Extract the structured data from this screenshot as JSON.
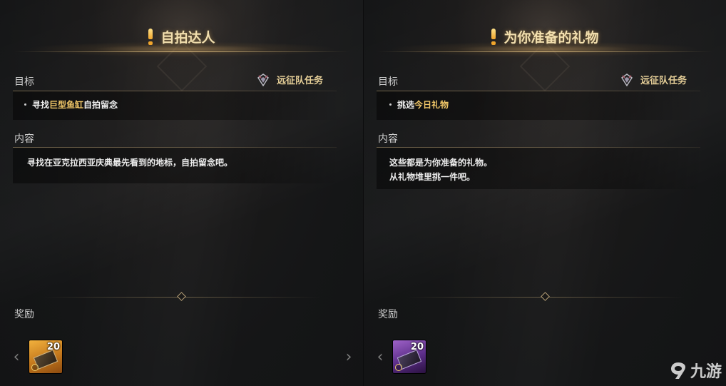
{
  "panels": [
    {
      "title": "自拍达人",
      "objective_label": "目标",
      "quest_type": "远征队任务",
      "objective": {
        "prefix": "寻找",
        "highlight": "巨型鱼缸",
        "suffix": "自拍留念"
      },
      "content_label": "内容",
      "content_lines": [
        "寻找在亚克拉西亚庆典最先看到的地标，自拍留念吧。"
      ],
      "reward_label": "奖励",
      "reward": {
        "count": "20",
        "rarity_color": "#d88f24",
        "icon": "ticket-icon"
      }
    },
    {
      "title": "为你准备的礼物",
      "objective_label": "目标",
      "quest_type": "远征队任务",
      "objective": {
        "prefix": "挑选",
        "highlight": "今日礼物",
        "suffix": ""
      },
      "content_label": "内容",
      "content_lines": [
        "这些都是为你准备的礼物。",
        "从礼物堆里挑一件吧。"
      ],
      "reward_label": "奖励",
      "reward": {
        "count": "20",
        "rarity_color": "#7a44a8",
        "icon": "ticket-icon"
      }
    }
  ],
  "watermark": {
    "text": "九游",
    "icon": "jiuyou-logo-icon"
  },
  "colors": {
    "title": "#f2dfae",
    "highlight": "#f1c768",
    "quest_type": "#e6cf98"
  }
}
